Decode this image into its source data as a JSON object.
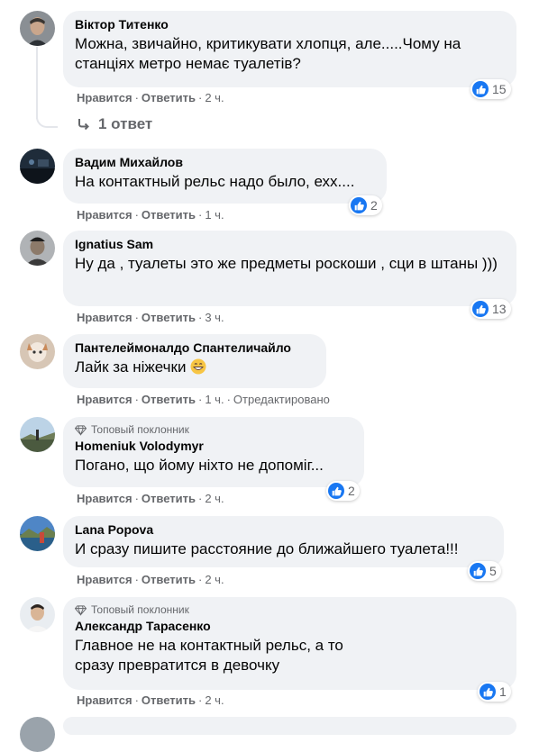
{
  "actions": {
    "like": "Нравится",
    "reply": "Ответить",
    "edited": "Отредактировано"
  },
  "reply_link": "1 ответ",
  "top_fan_label": "Топовый поклонник",
  "comments": [
    {
      "author": "Віктор Титенко",
      "text": "Можна, звичайно, критикувати хлопця, але.....Чому на станціях метро немає туалетів?",
      "time": "2 ч.",
      "reactions": "15"
    },
    {
      "author": "Вадим Михайлов",
      "text": "На контактный рельс надо было, ехх....",
      "time": "1 ч.",
      "reactions": "2"
    },
    {
      "author": "Ignatius Sam",
      "text": "Ну да , туалеты это же предметы роскоши , сци в штаны )))",
      "time": "3 ч.",
      "reactions": "13"
    },
    {
      "author": "Пантелеймоналдо Спантеличайло",
      "text": "Лайк за ніжечки",
      "emoji": "grinning-face-emoji",
      "time": "1 ч.",
      "edited": true
    },
    {
      "author": "Homeniuk Volodymyr",
      "top_fan": true,
      "text": "Погано, що йому ніхто не допоміг...",
      "time": "2 ч.",
      "reactions": "2"
    },
    {
      "author": "Lana Popova",
      "text": "И сразу пишите расстояние до ближайшего туалета!!!",
      "time": "2 ч.",
      "reactions": "5"
    },
    {
      "author": "Александр Тарасенко",
      "top_fan": true,
      "text": "Главное не на контактный рельс, а то сразу превратится в девочку",
      "time": "2 ч.",
      "reactions": "1"
    }
  ],
  "colors": {
    "accent": "#1877f2",
    "bubble": "#f0f2f5",
    "secondary_text": "#65676b"
  }
}
